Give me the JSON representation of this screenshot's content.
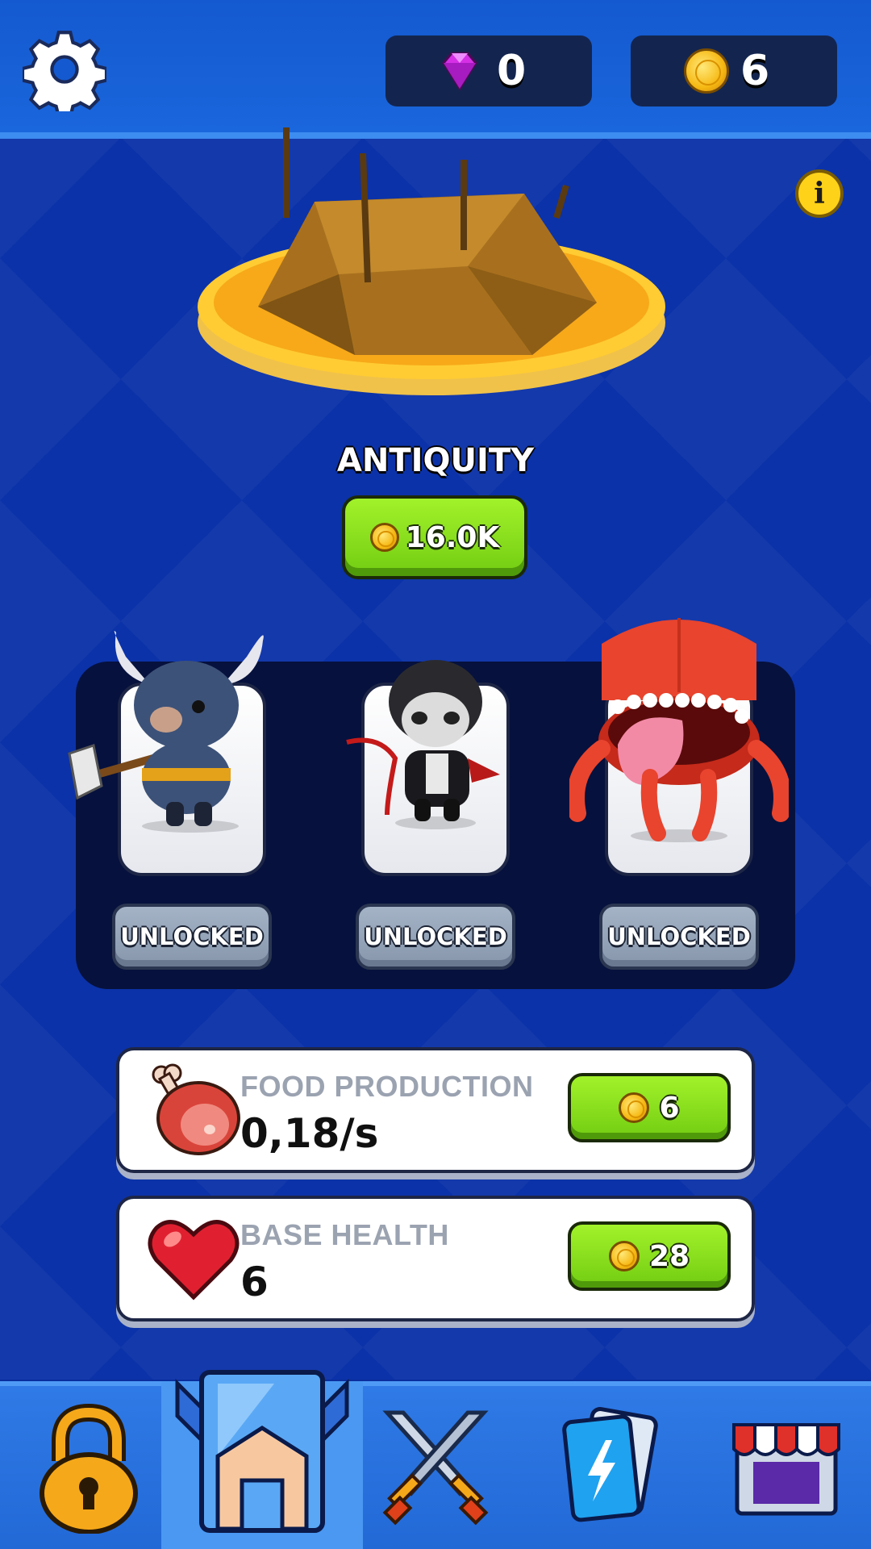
{
  "header": {
    "settings_icon": "gear-icon",
    "gems": {
      "icon": "gem-icon",
      "value": "0"
    },
    "coins": {
      "icon": "coin-icon",
      "value": "6"
    },
    "info_icon": "info-icon",
    "info_glyph": "i"
  },
  "era": {
    "title": "ANTIQUITY",
    "cost": "16.0K"
  },
  "units": [
    {
      "name": "viking-bull",
      "status": "UNLOCKED"
    },
    {
      "name": "vampire",
      "status": "UNLOCKED"
    },
    {
      "name": "mimic-crab",
      "status": "UNLOCKED"
    }
  ],
  "upgrades": {
    "food": {
      "label": "FOOD PRODUCTION",
      "value": "0,18/s",
      "cost": "6",
      "icon": "meat-icon"
    },
    "health": {
      "label": "BASE HEALTH",
      "value": "6",
      "cost": "28",
      "icon": "heart-icon"
    }
  },
  "nav": {
    "items": [
      {
        "name": "lock",
        "icon": "padlock-icon"
      },
      {
        "name": "armor",
        "icon": "helmet-icon",
        "active": true
      },
      {
        "name": "battle",
        "icon": "crossed-swords-icon"
      },
      {
        "name": "cards",
        "icon": "cards-icon"
      },
      {
        "name": "shop",
        "icon": "shop-icon"
      }
    ]
  },
  "colors": {
    "background": "#0b32a8",
    "topbar": "#1459cf",
    "green_button": "#8ee01f",
    "gray_button": "#95a4b9",
    "panel": "#06113d"
  }
}
